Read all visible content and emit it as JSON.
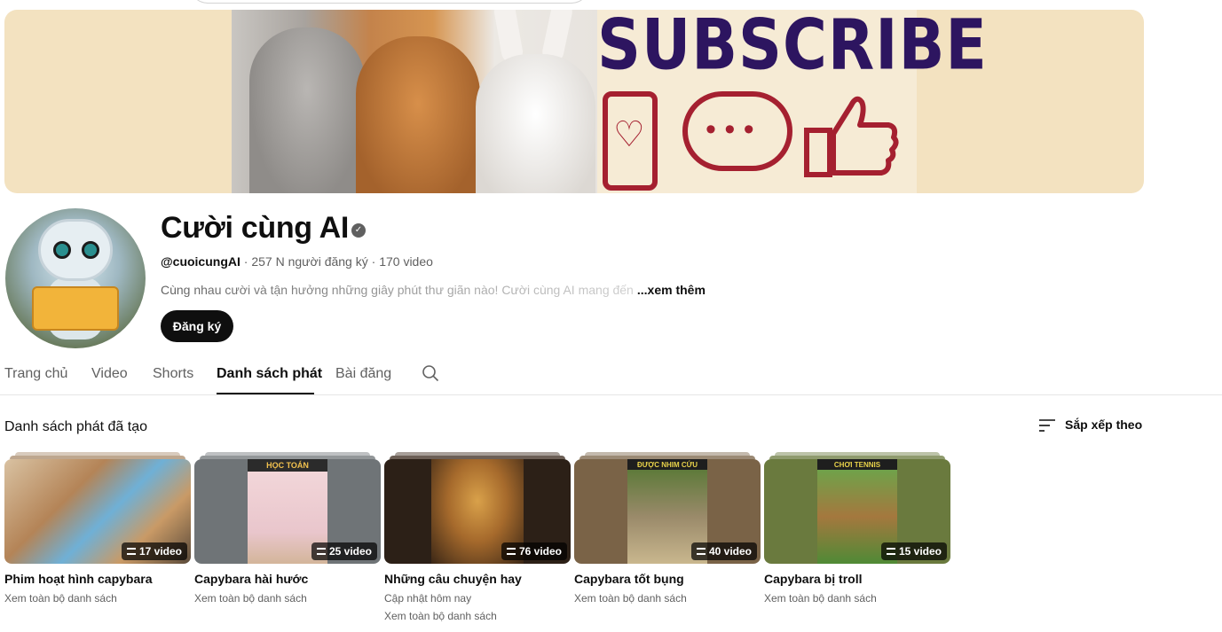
{
  "banner": {
    "subscribe_text": "SUBSCRIBE"
  },
  "channel": {
    "name": "Cười cùng AI",
    "handle": "@cuoicungAI",
    "subscribers": "257 N người đăng ký",
    "videos": "170 video",
    "separator": "·",
    "description": "Cùng nhau cười và tận hưởng những giây phút thư giãn nào! Cười cùng AI mang đến",
    "more_label": "...xem thêm",
    "subscribe_label": "Đăng ký",
    "verified_icon": "verified-check-icon"
  },
  "tabs": [
    {
      "label": "Trang chủ"
    },
    {
      "label": "Video"
    },
    {
      "label": "Shorts"
    },
    {
      "label": "Danh sách phát",
      "active": true
    },
    {
      "label": "Bài đăng"
    }
  ],
  "section": {
    "title": "Danh sách phát đã tạo",
    "sort_label": "Sắp xếp theo"
  },
  "playlists": [
    {
      "title": "Phim hoạt hình capybara",
      "count": "17 video",
      "updated": "",
      "link": "Xem toàn bộ danh sách",
      "thumb_color": "#a88a6a"
    },
    {
      "title": "Capybara hài hước",
      "count": "25 video",
      "updated": "",
      "link": "Xem toàn bộ danh sách",
      "thumb_color": "#6f7477",
      "thumb_text": "HỌC TOÁN"
    },
    {
      "title": "Những câu chuyện hay",
      "count": "76 video",
      "updated": "Cập nhật hôm nay",
      "link": "Xem toàn bộ danh sách",
      "thumb_color": "#3b2a1d"
    },
    {
      "title": "Capybara tốt bụng",
      "count": "40 video",
      "updated": "",
      "link": "Xem toàn bộ danh sách",
      "thumb_color": "#7a6347",
      "thumb_text": "ĐƯỢC NHIM CỨU"
    },
    {
      "title": "Capybara bị troll",
      "count": "15 video",
      "updated": "",
      "link": "Xem toàn bộ danh sách",
      "thumb_color": "#6a7a3e",
      "thumb_text": "CHƠI TENNIS"
    }
  ],
  "colors": {
    "banner_bg": "#f3e2c0",
    "subscribe_purple": "#2d1560",
    "icon_red": "#a52030",
    "text_primary": "#0f0f0f",
    "text_secondary": "#606060"
  }
}
